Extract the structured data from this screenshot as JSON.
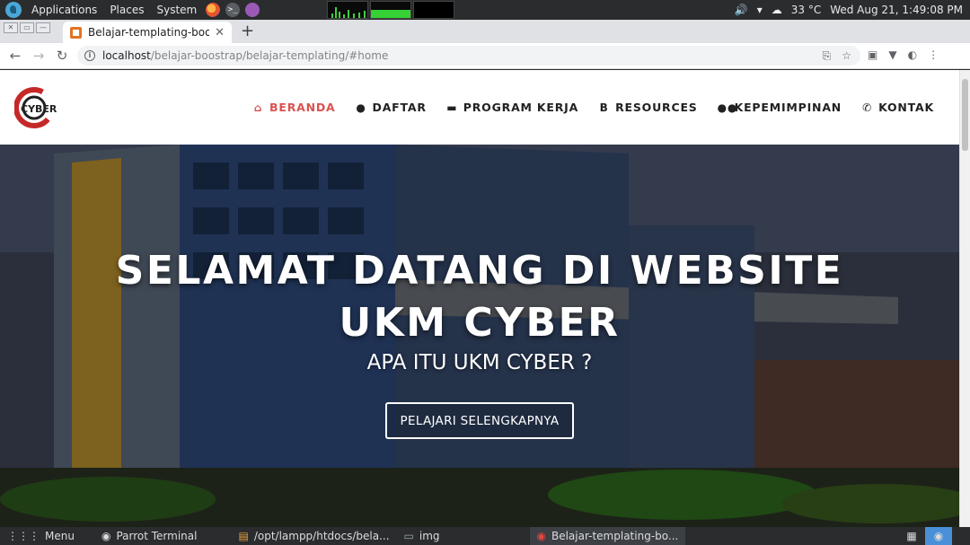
{
  "system_panel": {
    "menus": [
      "Applications",
      "Places",
      "System"
    ],
    "weather": "33 °C",
    "clock": "Wed Aug 21,  1:49:08 PM"
  },
  "browser": {
    "tab_title": "Belajar-templating-boots",
    "url_host": "localhost",
    "url_path": "/belajar-boostrap/belajar-templating/#home"
  },
  "site": {
    "logo_text": "CYBER",
    "nav": [
      {
        "label": "BERANDA",
        "icon": "home-icon",
        "active": true
      },
      {
        "label": "DAFTAR",
        "icon": "user-icon",
        "active": false
      },
      {
        "label": "PROGRAM KERJA",
        "icon": "briefcase-icon",
        "active": false
      },
      {
        "label": "RESOURCES",
        "icon": "bitcoin-icon",
        "active": false
      },
      {
        "label": "KEPEMIMPINAN",
        "icon": "users-icon",
        "active": false
      },
      {
        "label": "KONTAK",
        "icon": "phone-icon",
        "active": false
      }
    ],
    "hero": {
      "title": "SELAMAT DATANG DI WEBSITE UKM CYBER",
      "subtitle": "APA ITU UKM CYBER ?",
      "button": "PELAJARI SELENGKAPNYA"
    }
  },
  "taskbar": {
    "menu": "Menu",
    "tasks": [
      {
        "label": "Parrot Terminal"
      },
      {
        "label": "/opt/lampp/htdocs/bela..."
      },
      {
        "label": "img"
      },
      {
        "label": "Belajar-templating-bo...",
        "active": true
      }
    ]
  },
  "colors": {
    "accent": "#d9534f",
    "panel": "#2a2c2e"
  }
}
